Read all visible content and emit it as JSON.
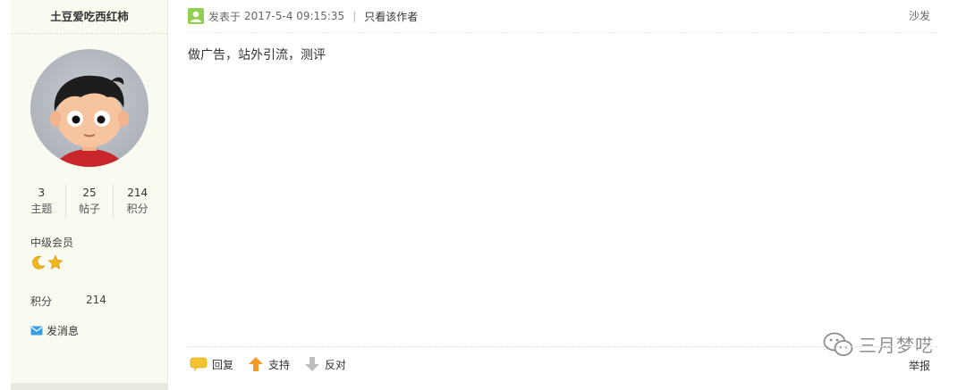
{
  "author": {
    "name": "土豆爱吃西红柿",
    "stats": [
      {
        "value": "3",
        "label": "主题"
      },
      {
        "value": "25",
        "label": "帖子"
      },
      {
        "value": "214",
        "label": "积分"
      }
    ],
    "level": "中级会员",
    "level_icons": [
      "moon-icon",
      "star-icon"
    ],
    "credits_label": "积分",
    "credits_value": "214",
    "send_message": "发消息"
  },
  "post": {
    "posted_prefix": "发表于",
    "posted_time": "2017-5-4 09:15:35",
    "only_author": "只看该作者",
    "floor": "沙发",
    "content": "做广告，站外引流，测评"
  },
  "actions": {
    "reply": "回复",
    "support": "支持",
    "oppose": "反对",
    "report": "举报"
  },
  "watermark": {
    "text": "三月梦呓"
  },
  "colors": {
    "sidebar_bg": "#f9fbf0",
    "online_icon": "#8fd14f",
    "support_arrow": "#f39a2b",
    "oppose_arrow": "#bdbdbd",
    "reply_icon": "#f4c430",
    "level_icon": "#f2b81b"
  }
}
